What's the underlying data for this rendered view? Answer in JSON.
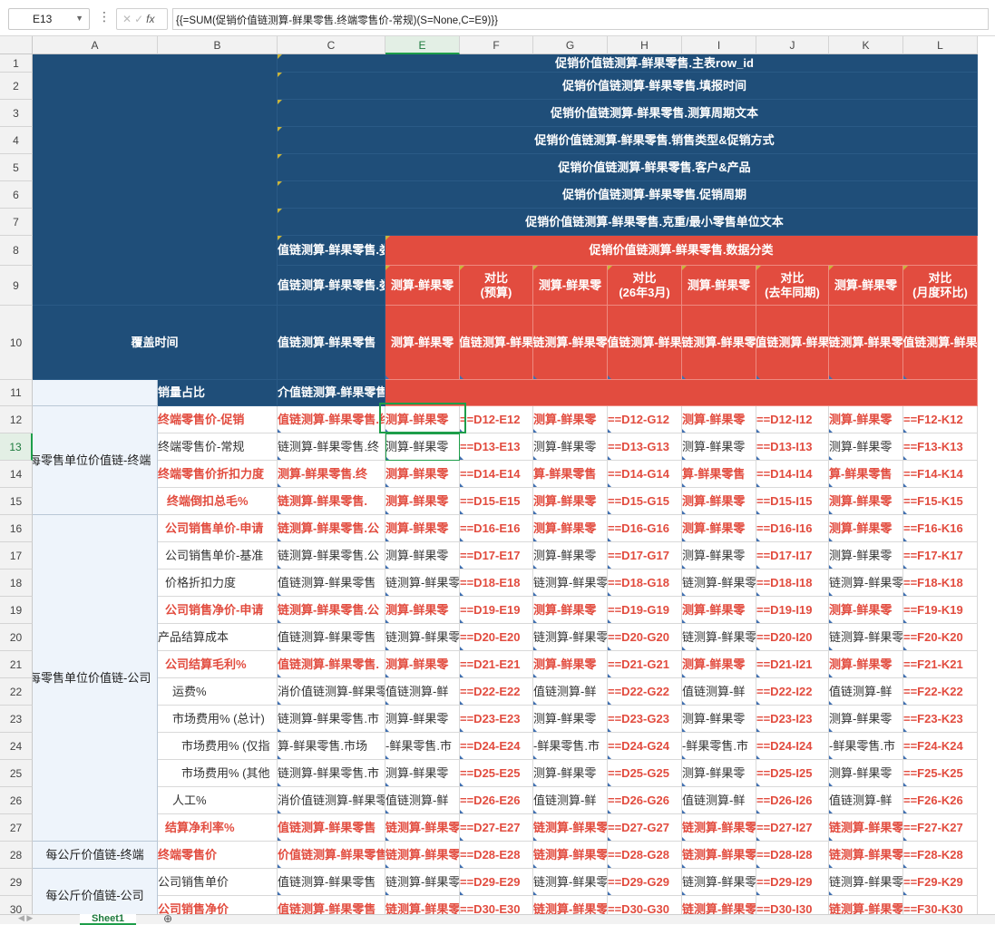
{
  "formula_bar": {
    "name_box": "E13",
    "fx_label": "fx",
    "formula": "{{=SUM(促销价值链测算-鲜果零售.终端零售价-常规)(S=None,C=E9)}}"
  },
  "columns": [
    "A",
    "B",
    "C",
    "E",
    "F",
    "G",
    "H",
    "I",
    "J",
    "K",
    "L"
  ],
  "selected_column": "E",
  "rows": [
    "1",
    "2",
    "3",
    "4",
    "5",
    "6",
    "7",
    "8",
    "9",
    "10",
    "11",
    "12",
    "13",
    "14",
    "15",
    "16",
    "17",
    "18",
    "19",
    "20",
    "21",
    "22",
    "23",
    "24",
    "25",
    "26",
    "27",
    "28",
    "29",
    "30"
  ],
  "selected_row": "13",
  "header": {
    "row1": "促销价值链测算-鲜果零售.主表row_id",
    "row2": "促销价值链测算-鲜果零售.填报时间",
    "row3": "促销价值链测算-鲜果零售.测算周期文本",
    "row4": "促销价值链测算-鲜果零售.销售类型&促销方式",
    "row5": "促销价值链测算-鲜果零售.客户&产品",
    "row6": "促销价值链测算-鲜果零售.促销周期",
    "row7": "促销价值链测算-鲜果零售.克重/最小零售单位文本",
    "c8": "值链测算-鲜果零售.娄",
    "e8": "促销价值链测算-鲜果零售.数据分类",
    "c9": "值链测算-鲜果零售.娄",
    "row9": [
      "测算-鲜果零",
      "对比\n(预算)",
      "测算-鲜果零",
      "对比\n(26年3月)",
      "测算-鲜果零",
      "对比\n(去年同期)",
      "测算-鲜果零",
      "对比\n(月度环比)"
    ],
    "a10": "覆盖时间",
    "c10": "值链测算-鲜果零售",
    "row10": [
      "测算-鲜果零",
      "值链测算-鲜果",
      "链测算-鲜果零",
      "值链测算-鲜果",
      "链测算-鲜果零",
      "值链测算-鲜果",
      "链测算-鲜果零",
      "值链测算-鲜果"
    ],
    "b11": "销量占比",
    "c11": "介值链测算-鲜果零售"
  },
  "groups": [
    {
      "label": "每零售单位价值链-终端"
    },
    {
      "label": "每零售单位价值链-公司"
    },
    {
      "label": "每公斤价值链-终端"
    },
    {
      "label": "每公斤价值链-公司"
    }
  ],
  "body_rows": [
    {
      "b": "终端零售价-促销",
      "c": "值链测算-鲜果零售.终",
      "e": "测算-鲜果零",
      "bold": true,
      "cells": [
        "==D12-E12",
        "测算-鲜果零",
        "==D12-G12",
        "测算-鲜果零",
        "==D12-I12",
        "测算-鲜果零",
        "==F12-K12"
      ]
    },
    {
      "b": "终端零售价-常规",
      "c": "链测算-鲜果零售.终",
      "e": "测算-鲜果零",
      "bold": false,
      "cells": [
        "==D13-E13",
        "测算-鲜果零",
        "==D13-G13",
        "测算-鲜果零",
        "==D13-I13",
        "测算-鲜果零",
        "==F13-K13"
      ]
    },
    {
      "b": "终端零售价折扣力度",
      "c": "测算-鲜果零售.终",
      "e": "测算-鲜果零",
      "bold": true,
      "cells": [
        "==D14-E14",
        "算-鲜果零售",
        "==D14-G14",
        "算-鲜果零售",
        "==D14-I14",
        "算-鲜果零售",
        "==F14-K14"
      ]
    },
    {
      "b": "终端倒扣总毛%",
      "c": "链测算-鲜果零售.",
      "e": "测算-鲜果零",
      "bold": true,
      "cells": [
        "==D15-E15",
        "测算-鲜果零",
        "==D15-G15",
        "测算-鲜果零",
        "==D15-I15",
        "测算-鲜果零",
        "==F15-K15"
      ]
    },
    {
      "b": "公司销售单价-申请",
      "c": "链测算-鲜果零售.公",
      "e": "测算-鲜果零",
      "bold": true,
      "cells": [
        "==D16-E16",
        "测算-鲜果零",
        "==D16-G16",
        "测算-鲜果零",
        "==D16-I16",
        "测算-鲜果零",
        "==F16-K16"
      ]
    },
    {
      "b": "公司销售单价-基准",
      "c": "链测算-鲜果零售.公",
      "e": "测算-鲜果零",
      "bold": false,
      "cells": [
        "==D17-E17",
        "测算-鲜果零",
        "==D17-G17",
        "测算-鲜果零",
        "==D17-I17",
        "测算-鲜果零",
        "==F17-K17"
      ]
    },
    {
      "b": "价格折扣力度",
      "c": "值链测算-鲜果零售",
      "e": "链测算-鲜果零",
      "bold": false,
      "cells": [
        "==D18-E18",
        "链测算-鲜果零",
        "==D18-G18",
        "链测算-鲜果零",
        "==D18-I18",
        "链测算-鲜果零",
        "==F18-K18"
      ]
    },
    {
      "b": "公司销售净价-申请",
      "c": "链测算-鲜果零售.公",
      "e": "测算-鲜果零",
      "bold": true,
      "cells": [
        "==D19-E19",
        "测算-鲜果零",
        "==D19-G19",
        "测算-鲜果零",
        "==D19-I19",
        "测算-鲜果零",
        "==F19-K19"
      ]
    },
    {
      "b": "产品结算成本",
      "c": "值链测算-鲜果零售",
      "e": "链测算-鲜果零",
      "bold": false,
      "cells": [
        "==D20-E20",
        "链测算-鲜果零",
        "==D20-G20",
        "链测算-鲜果零",
        "==D20-I20",
        "链测算-鲜果零",
        "==F20-K20"
      ]
    },
    {
      "b": "公司结算毛利%",
      "c": "值链测算-鲜果零售.",
      "e": "测算-鲜果零",
      "bold": true,
      "cells": [
        "==D21-E21",
        "测算-鲜果零",
        "==D21-G21",
        "测算-鲜果零",
        "==D21-I21",
        "测算-鲜果零",
        "==F21-K21"
      ]
    },
    {
      "b": "运费%",
      "c": "消价值链测算-鲜果零",
      "e": "值链测算-鲜",
      "bold": false,
      "cells": [
        "==D22-E22",
        "值链测算-鲜",
        "==D22-G22",
        "值链测算-鲜",
        "==D22-I22",
        "值链测算-鲜",
        "==F22-K22"
      ]
    },
    {
      "b": "市场费用% (总计)",
      "c": "链测算-鲜果零售.市",
      "e": "测算-鲜果零",
      "bold": false,
      "cells": [
        "==D23-E23",
        "测算-鲜果零",
        "==D23-G23",
        "测算-鲜果零",
        "==D23-I23",
        "测算-鲜果零",
        "==F23-K23"
      ]
    },
    {
      "b": "市场费用% (仅指",
      "c": "算-鲜果零售.市场",
      "e": "-鲜果零售.市",
      "bold": false,
      "cells": [
        "==D24-E24",
        "-鲜果零售.市",
        "==D24-G24",
        "-鲜果零售.市",
        "==D24-I24",
        "-鲜果零售.市",
        "==F24-K24"
      ]
    },
    {
      "b": "市场费用% (其他",
      "c": "链测算-鲜果零售.市",
      "e": "测算-鲜果零",
      "bold": false,
      "cells": [
        "==D25-E25",
        "测算-鲜果零",
        "==D25-G25",
        "测算-鲜果零",
        "==D25-I25",
        "测算-鲜果零",
        "==F25-K25"
      ]
    },
    {
      "b": "人工%",
      "c": "消价值链测算-鲜果零",
      "e": "值链测算-鲜",
      "bold": false,
      "cells": [
        "==D26-E26",
        "值链测算-鲜",
        "==D26-G26",
        "值链测算-鲜",
        "==D26-I26",
        "值链测算-鲜",
        "==F26-K26"
      ]
    },
    {
      "b": "结算净利率%",
      "c": "值链测算-鲜果零售",
      "e": "链测算-鲜果零",
      "bold": true,
      "cells": [
        "==D27-E27",
        "链测算-鲜果零",
        "==D27-G27",
        "链测算-鲜果零",
        "==D27-I27",
        "链测算-鲜果零",
        "==F27-K27"
      ]
    },
    {
      "b": "终端零售价",
      "c": "价值链测算-鲜果零售",
      "e": "链测算-鲜果零",
      "bold": true,
      "cells": [
        "==D28-E28",
        "链测算-鲜果零",
        "==D28-G28",
        "链测算-鲜果零",
        "==D28-I28",
        "链测算-鲜果零",
        "==F28-K28"
      ]
    },
    {
      "b": "公司销售单价",
      "c": "值链测算-鲜果零售",
      "e": "链测算-鲜果零",
      "bold": false,
      "cells": [
        "==D29-E29",
        "链测算-鲜果零",
        "==D29-G29",
        "链测算-鲜果零",
        "==D29-I29",
        "链测算-鲜果零",
        "==F29-K29"
      ]
    },
    {
      "b": "公司销售净价",
      "c": "值链测算-鲜果零售",
      "e": "链测算-鲜果零",
      "bold": true,
      "cells": [
        "==D30-E30",
        "链测算-鲜果零",
        "==D30-G30",
        "链测算-鲜果零",
        "==D30-I30",
        "链测算-鲜果零",
        "==F30-K30"
      ]
    }
  ],
  "sheet_tab": "Sheet1",
  "add_sheet_icon": "plus-circle-icon",
  "colors": {
    "navy": "#1f4e79",
    "red": "#e24c3f",
    "selection": "#1e9e4a",
    "light_blue": "#eef4fb"
  }
}
